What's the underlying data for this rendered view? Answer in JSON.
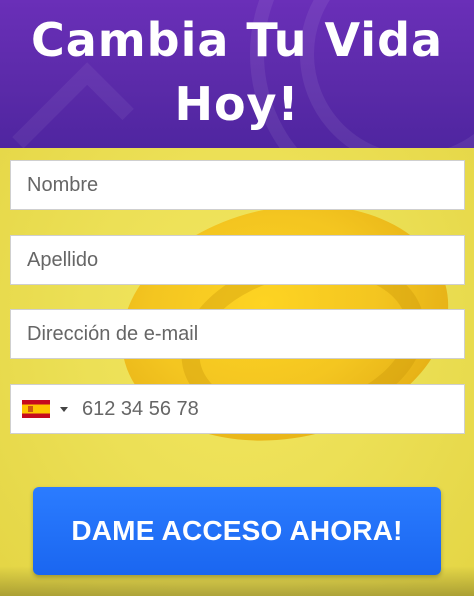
{
  "header": {
    "title": "Cambia Tu Vida Hoy!"
  },
  "form": {
    "first_name": {
      "placeholder": "Nombre",
      "value": ""
    },
    "last_name": {
      "placeholder": "Apellido",
      "value": ""
    },
    "email": {
      "placeholder": "Dirección de e-mail",
      "value": ""
    },
    "phone": {
      "country_flag": "spain-flag-icon",
      "placeholder": "612 34 56 78",
      "value": ""
    },
    "submit_label": "DAME ACCESO AHORA!"
  },
  "colors": {
    "header_purple": "#5a2aa8",
    "body_yellow": "#ece056",
    "coin_gold": "#f4c21a",
    "button_blue": "#1a66f0",
    "text_white": "#ffffff"
  }
}
